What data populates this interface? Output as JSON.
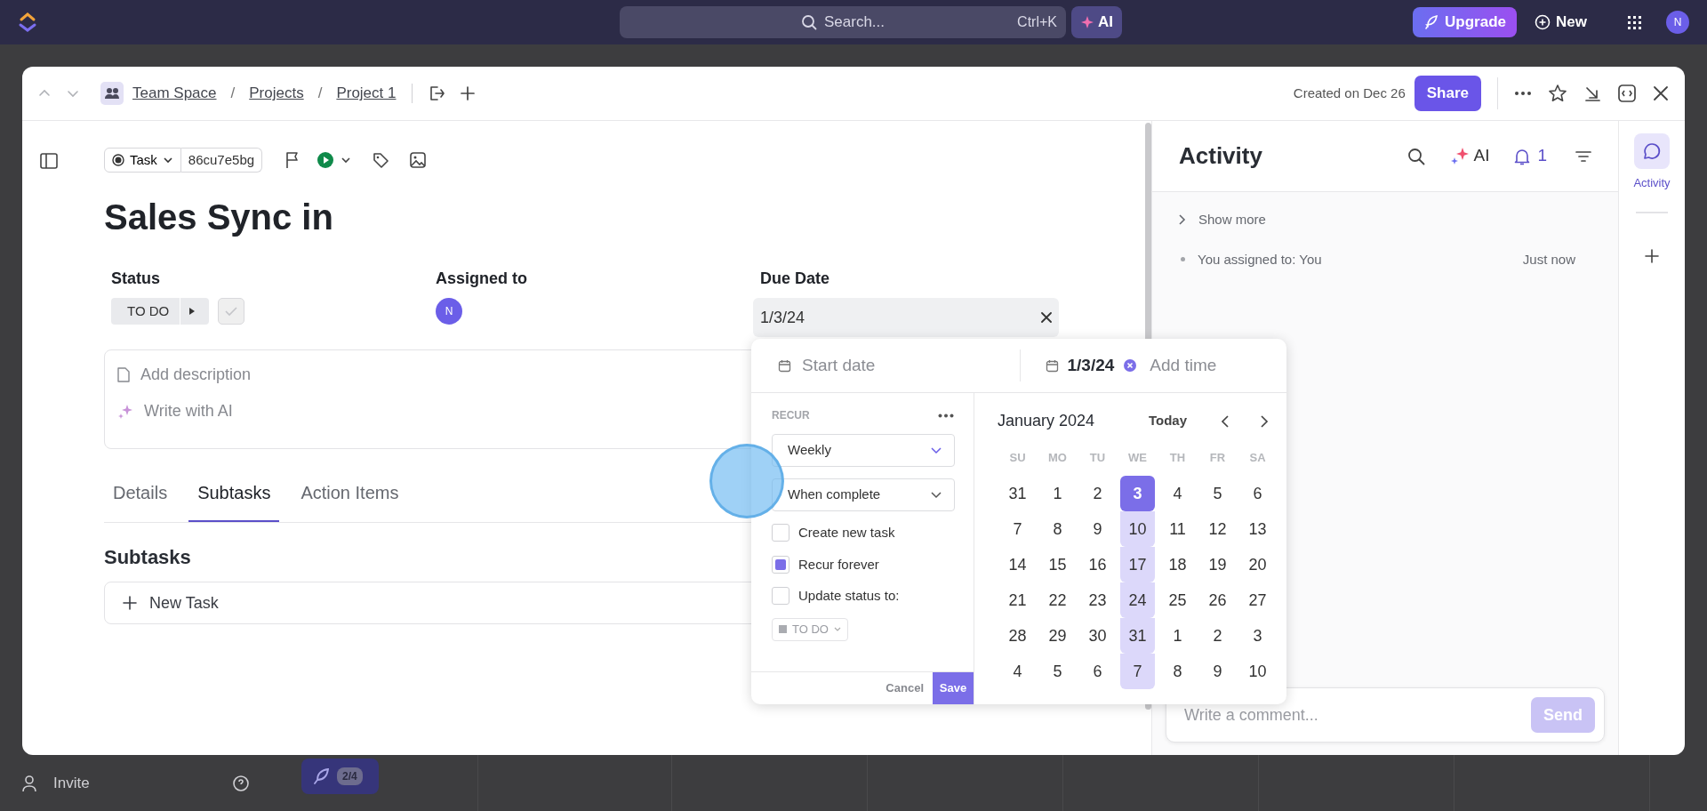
{
  "topbar": {
    "search_placeholder": "Search...",
    "shortcut": "Ctrl+K",
    "ai": "AI",
    "upgrade": "Upgrade",
    "new": "New",
    "avatar": "N"
  },
  "background": {
    "invite": "Invite",
    "progress": "2/4"
  },
  "modal": {
    "breadcrumb": [
      "Team Space",
      "Projects",
      "Project 1"
    ],
    "separator": "/",
    "created": "Created on Dec 26",
    "share": "Share"
  },
  "task": {
    "type": "Task",
    "id": "86cu7e5bg",
    "title": "Sales Sync in"
  },
  "fields": [
    {
      "kind": "status",
      "label": "Status",
      "value": "TO DO",
      "completed": false
    },
    {
      "kind": "assignee",
      "label": "Assigned to",
      "value": "N"
    },
    {
      "kind": "date",
      "label": "Due Date",
      "value": "1/3/24"
    }
  ],
  "description": {
    "placeholder": "Add description",
    "ai": "Write with AI"
  },
  "tabs": [
    {
      "label": "Details",
      "selected": false
    },
    {
      "label": "Subtasks",
      "selected": true
    },
    {
      "label": "Action Items",
      "selected": false
    }
  ],
  "subtasks": {
    "heading": "Subtasks",
    "new_task": "New Task"
  },
  "date_picker": {
    "start_placeholder": "Start date",
    "due": "1/3/24",
    "time_placeholder": "Add time",
    "recur_label": "RECUR",
    "frequency": "Weekly",
    "mode": "When complete",
    "options": [
      {
        "label": "Create new task",
        "checked": false
      },
      {
        "label": "Recur forever",
        "checked": true
      },
      {
        "label": "Update status to:",
        "checked": false
      }
    ],
    "status": "TO DO",
    "cancel": "Cancel",
    "save": "Save",
    "month": "January 2024",
    "today": "Today",
    "weekdays": [
      "SU",
      "MO",
      "TU",
      "WE",
      "TH",
      "FR",
      "SA"
    ],
    "weeks": [
      [
        {
          "day": "31",
          "selected": false,
          "recurring": false
        },
        {
          "day": "1",
          "selected": false,
          "recurring": false
        },
        {
          "day": "2",
          "selected": false,
          "recurring": false
        },
        {
          "day": "3",
          "selected": true,
          "recurring": false
        },
        {
          "day": "4",
          "selected": false,
          "recurring": false
        },
        {
          "day": "5",
          "selected": false,
          "recurring": false
        },
        {
          "day": "6",
          "selected": false,
          "recurring": false
        }
      ],
      [
        {
          "day": "7",
          "selected": false,
          "recurring": false
        },
        {
          "day": "8",
          "selected": false,
          "recurring": false
        },
        {
          "day": "9",
          "selected": false,
          "recurring": false
        },
        {
          "day": "10",
          "selected": false,
          "recurring": true
        },
        {
          "day": "11",
          "selected": false,
          "recurring": false
        },
        {
          "day": "12",
          "selected": false,
          "recurring": false
        },
        {
          "day": "13",
          "selected": false,
          "recurring": false
        }
      ],
      [
        {
          "day": "14",
          "selected": false,
          "recurring": false
        },
        {
          "day": "15",
          "selected": false,
          "recurring": false
        },
        {
          "day": "16",
          "selected": false,
          "recurring": false
        },
        {
          "day": "17",
          "selected": false,
          "recurring": true
        },
        {
          "day": "18",
          "selected": false,
          "recurring": false
        },
        {
          "day": "19",
          "selected": false,
          "recurring": false
        },
        {
          "day": "20",
          "selected": false,
          "recurring": false
        }
      ],
      [
        {
          "day": "21",
          "selected": false,
          "recurring": false
        },
        {
          "day": "22",
          "selected": false,
          "recurring": false
        },
        {
          "day": "23",
          "selected": false,
          "recurring": false
        },
        {
          "day": "24",
          "selected": false,
          "recurring": true
        },
        {
          "day": "25",
          "selected": false,
          "recurring": false
        },
        {
          "day": "26",
          "selected": false,
          "recurring": false
        },
        {
          "day": "27",
          "selected": false,
          "recurring": false
        }
      ],
      [
        {
          "day": "28",
          "selected": false,
          "recurring": false
        },
        {
          "day": "29",
          "selected": false,
          "recurring": false
        },
        {
          "day": "30",
          "selected": false,
          "recurring": false
        },
        {
          "day": "31",
          "selected": false,
          "recurring": true
        },
        {
          "day": "1",
          "selected": false,
          "recurring": false
        },
        {
          "day": "2",
          "selected": false,
          "recurring": false
        },
        {
          "day": "3",
          "selected": false,
          "recurring": false
        }
      ],
      [
        {
          "day": "4",
          "selected": false,
          "recurring": false
        },
        {
          "day": "5",
          "selected": false,
          "recurring": false
        },
        {
          "day": "6",
          "selected": false,
          "recurring": false
        },
        {
          "day": "7",
          "selected": false,
          "recurring": true
        },
        {
          "day": "8",
          "selected": false,
          "recurring": false
        },
        {
          "day": "9",
          "selected": false,
          "recurring": false
        },
        {
          "day": "10",
          "selected": false,
          "recurring": false
        }
      ]
    ]
  },
  "activity": {
    "title": "Activity",
    "ai": "AI",
    "notifications": "1",
    "show_more": "Show more",
    "entries": [
      {
        "text": "You assigned to: You",
        "time": "Just now"
      }
    ],
    "comment_placeholder": "Write a comment...",
    "send": "Send"
  },
  "rail": [
    {
      "label": "Activity",
      "selected": true
    }
  ]
}
